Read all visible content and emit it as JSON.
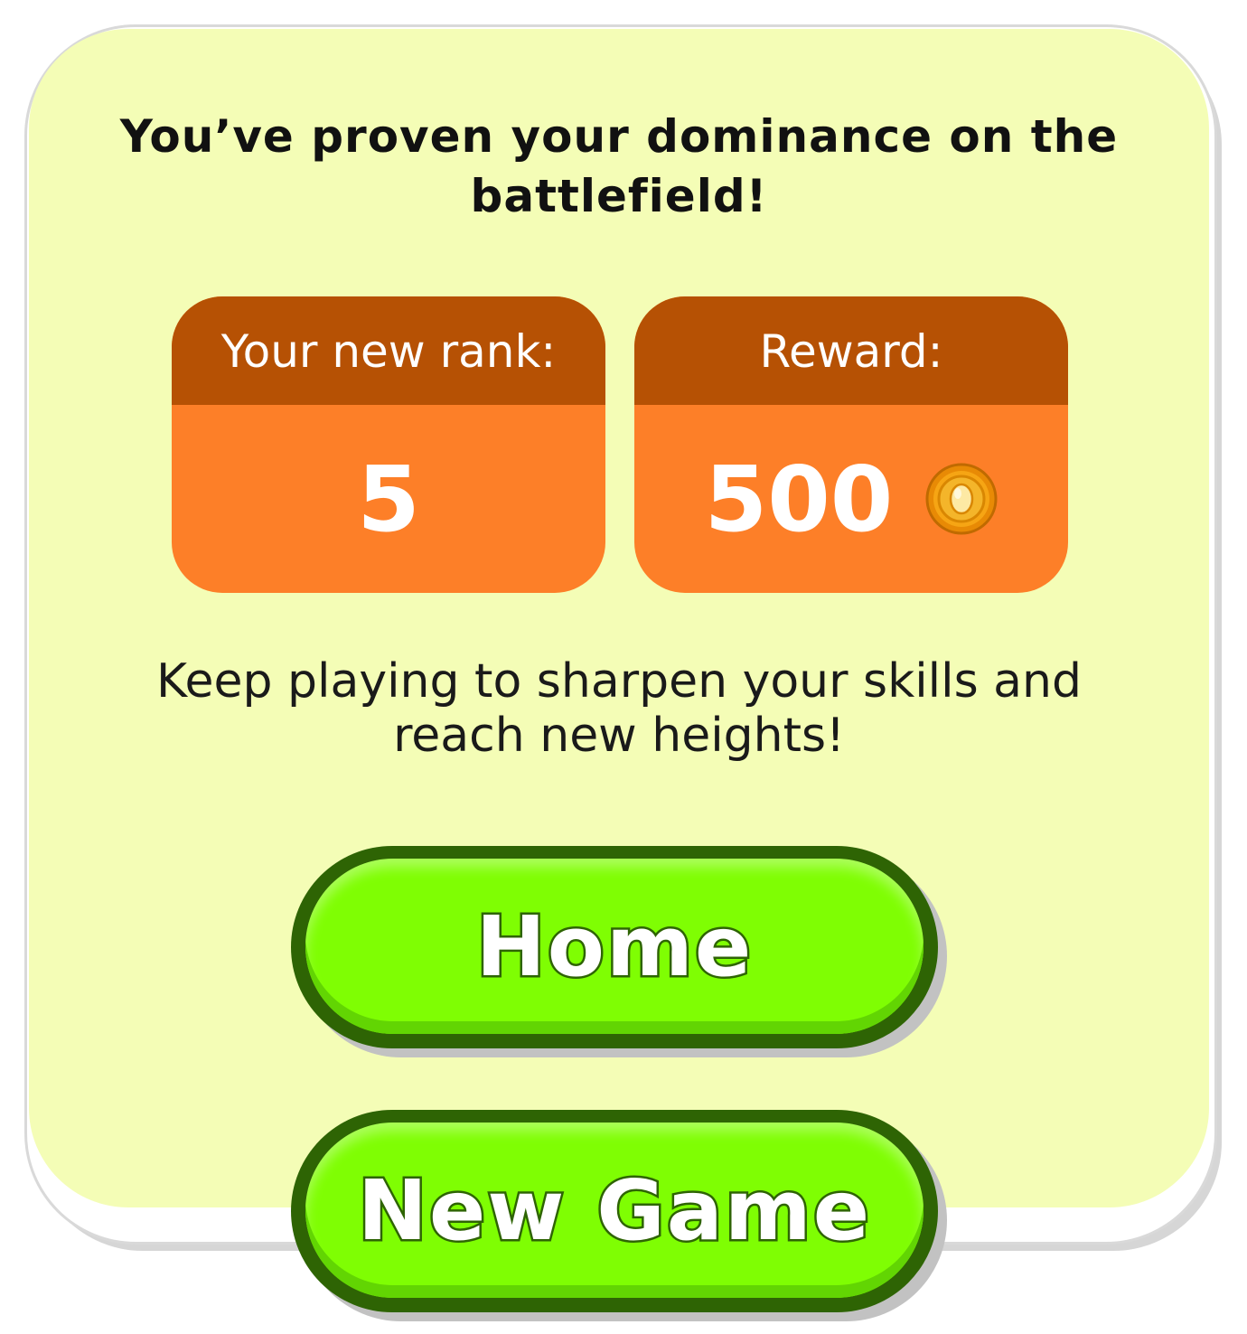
{
  "headline": "You’ve proven your dominance on the battlefield!",
  "rank_card": {
    "label": "Your new rank:",
    "value": "5"
  },
  "reward_card": {
    "label": "Reward:",
    "value": "500",
    "icon": "gold-coin-icon"
  },
  "message": "Keep playing to sharpen your skills and reach new heights!",
  "buttons": {
    "home": "Home",
    "new_game": "New Game"
  },
  "colors": {
    "panel_background": "#f4fdb6",
    "card_header": "#b65104",
    "card_body": "#fd7f28",
    "button_fill": "#7ffe03",
    "button_outline": "#2e6404",
    "coin_gold": "#f6a514"
  }
}
